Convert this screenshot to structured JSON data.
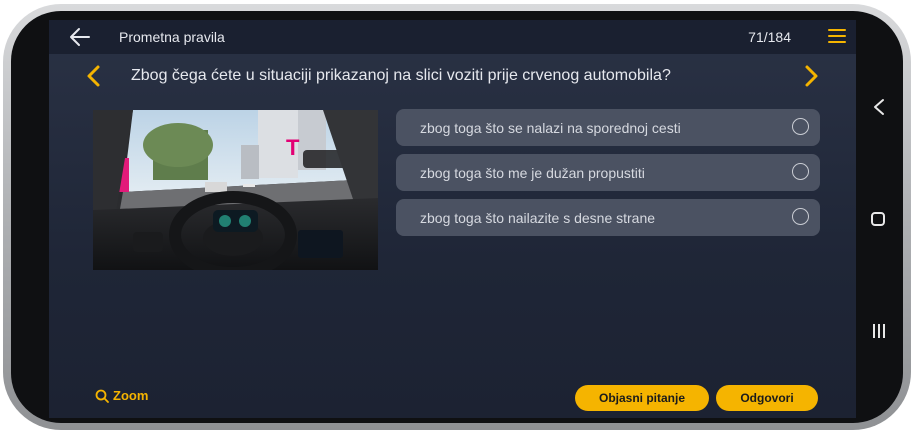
{
  "header": {
    "title": "Prometna pravila",
    "counter": "71/184"
  },
  "question": {
    "text": "Zbog čega ćete u situaciji prikazanoj na slici voziti prije  crvenog automobila?"
  },
  "answers": [
    {
      "label": "zbog toga što se nalazi na sporednoj cesti"
    },
    {
      "label": "zbog toga što me je dužan propustiti"
    },
    {
      "label": "zbog toga što nailazite s desne strane"
    }
  ],
  "footer": {
    "zoom_label": "Zoom",
    "explain_label": "Objasni pitanje",
    "answer_label": "Odgovori"
  },
  "colors": {
    "accent": "#f5b400",
    "background": "#232a3b",
    "answer_bg": "#4b5262"
  }
}
